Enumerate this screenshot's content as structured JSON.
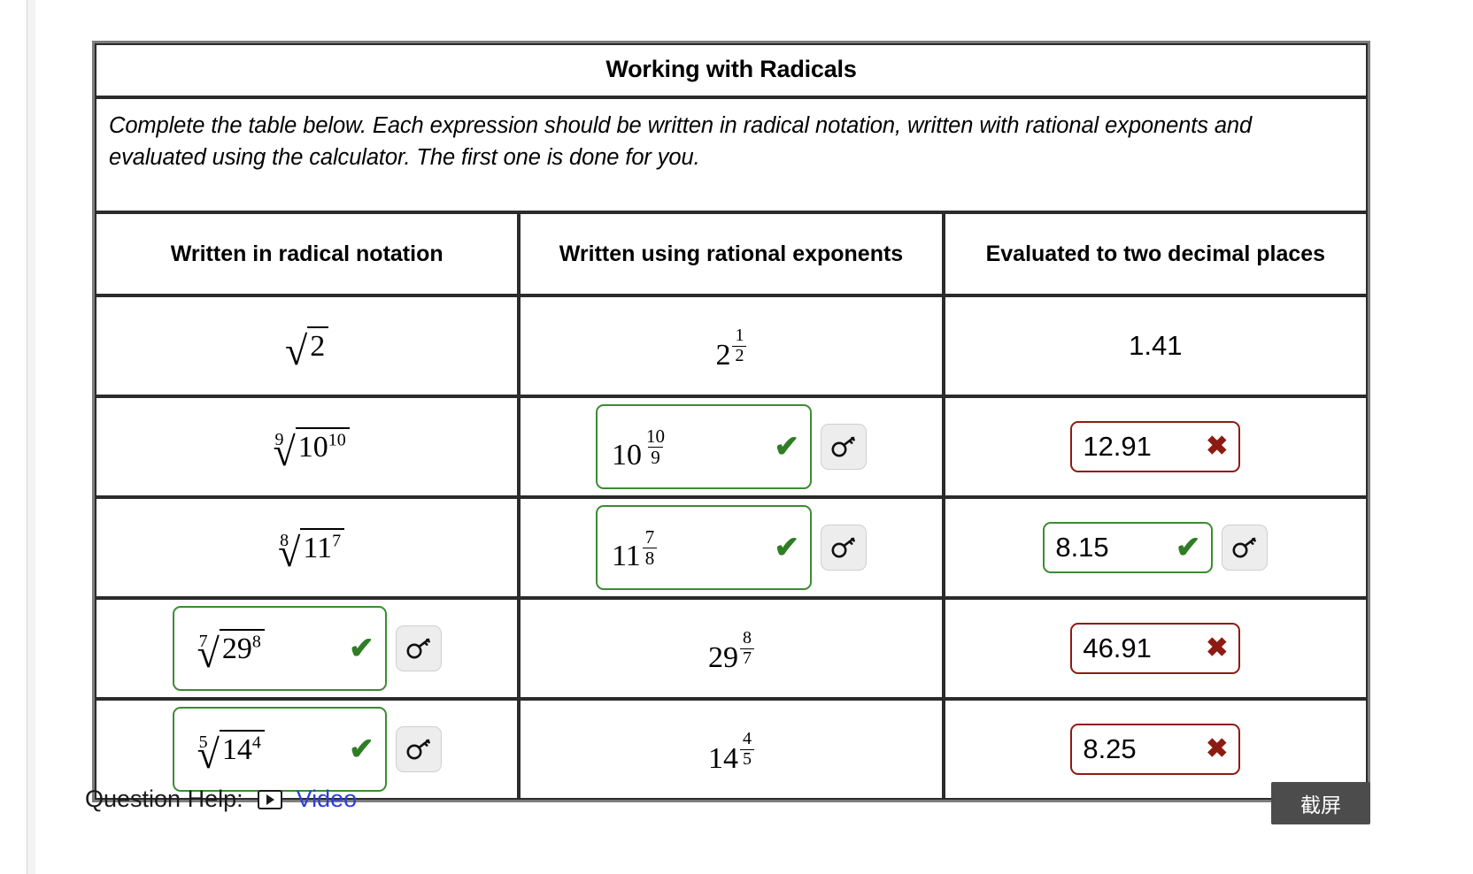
{
  "header": {
    "title": "Working with Radicals",
    "instructions": "Complete the table below. Each expression should be written in radical notation, written with rational exponents and evaluated using the calculator. The first one is done for you."
  },
  "columns": [
    "Written in radical notation",
    "Written using rational exponents",
    "Evaluated to two decimal places"
  ],
  "rows": [
    {
      "radical": {
        "index": "",
        "base": "2",
        "power": "",
        "editable": false,
        "status": "none"
      },
      "exponent": {
        "base": "2",
        "num": "1",
        "den": "2",
        "editable": false,
        "status": "none"
      },
      "value": {
        "text": "1.41",
        "editable": false,
        "status": "none"
      }
    },
    {
      "radical": {
        "index": "9",
        "base": "10",
        "power": "10",
        "editable": false,
        "status": "none"
      },
      "exponent": {
        "base": "10",
        "num": "10",
        "den": "9",
        "editable": true,
        "status": "correct"
      },
      "value": {
        "text": "12.91",
        "editable": true,
        "status": "incorrect"
      }
    },
    {
      "radical": {
        "index": "8",
        "base": "11",
        "power": "7",
        "editable": false,
        "status": "none"
      },
      "exponent": {
        "base": "11",
        "num": "7",
        "den": "8",
        "editable": true,
        "status": "correct"
      },
      "value": {
        "text": "8.15",
        "editable": true,
        "status": "correct"
      }
    },
    {
      "radical": {
        "index": "7",
        "base": "29",
        "power": "8",
        "editable": true,
        "status": "correct"
      },
      "exponent": {
        "base": "29",
        "num": "8",
        "den": "7",
        "editable": false,
        "status": "none"
      },
      "value": {
        "text": "46.91",
        "editable": true,
        "status": "incorrect"
      }
    },
    {
      "radical": {
        "index": "5",
        "base": "14",
        "power": "4",
        "editable": true,
        "status": "correct"
      },
      "exponent": {
        "base": "14",
        "num": "4",
        "den": "5",
        "editable": false,
        "status": "none"
      },
      "value": {
        "text": "8.25",
        "editable": true,
        "status": "incorrect"
      }
    }
  ],
  "marks": {
    "correct": "✔",
    "incorrect": "✖"
  },
  "icons": {
    "key": "key-icon",
    "video": "video-icon"
  },
  "footer": {
    "help_label": "Question Help:",
    "video_label": "Video"
  },
  "capture_button": {
    "label": "截屏"
  },
  "colors": {
    "correct_green": "#3c8b33",
    "incorrect_red": "#8c1c13",
    "link_blue": "#2a3fd8",
    "button_gray": "#4c4c4c"
  }
}
